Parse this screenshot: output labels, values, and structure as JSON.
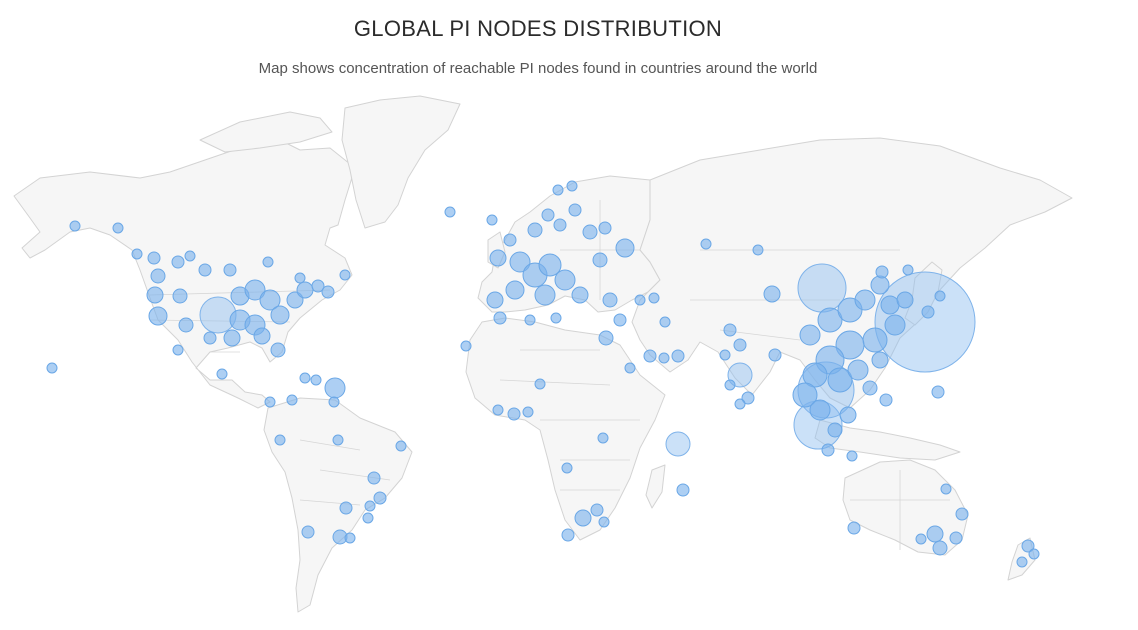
{
  "title": "GLOBAL PI NODES DISTRIBUTION",
  "subtitle": "Map shows concentration of reachable PI nodes found in countries around the world",
  "colors": {
    "background": "#ffffff",
    "land": "#f6f6f6",
    "land_border": "#d3d3d3",
    "node": "#7ab2ec"
  }
}
